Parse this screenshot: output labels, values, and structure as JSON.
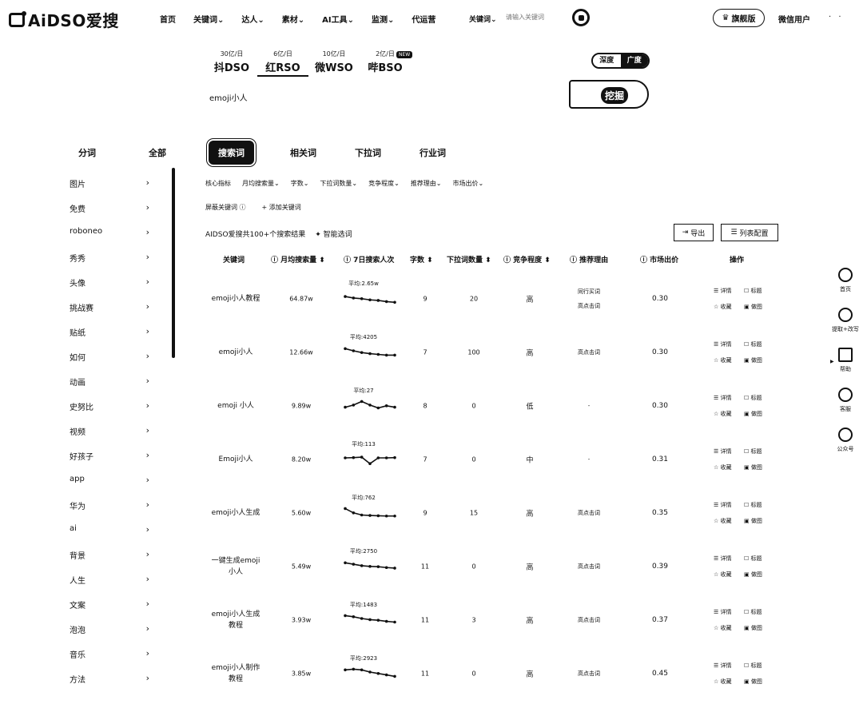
{
  "brand": {
    "name": "AiDSO爱搜"
  },
  "nav": {
    "items": [
      "首页",
      "关键词",
      "达人",
      "素材",
      "AI工具",
      "监测",
      "代运营"
    ],
    "keyword_select": "关键词",
    "search_placeholder": "请输入关键词",
    "flagship": "旗舰版",
    "user": "微信用户",
    "user_more": "· ·"
  },
  "engines": [
    {
      "volume": "30亿/日",
      "name": "抖DSO"
    },
    {
      "volume": "6亿/日",
      "name": "红RSO"
    },
    {
      "volume": "10亿/日",
      "name": "微WSO"
    },
    {
      "volume": "2亿/日",
      "name": "哔BSO"
    }
  ],
  "engine_badge": "NEW",
  "query": "emoji小人",
  "toggle": [
    "深度",
    "广度"
  ],
  "dig_button": "挖掘",
  "left_panel": {
    "tabs": [
      "分词",
      "全部"
    ],
    "categories": [
      "图片",
      "免费",
      "roboneo",
      "秀秀",
      "头像",
      "挑战赛",
      "贴纸",
      "如何",
      "动画",
      "史努比",
      "视频",
      "好孩子",
      "app",
      "华为",
      "ai",
      "背景",
      "人生",
      "文案",
      "泡泡",
      "音乐",
      "方法"
    ],
    "chevron": "›"
  },
  "main_tabs": [
    "搜索词",
    "相关词",
    "下拉词",
    "行业词"
  ],
  "filters": [
    "核心指标",
    "月均搜索量⌄",
    "字数⌄",
    "下拉词数量⌄",
    "竞争程度⌄",
    "推荐理由⌄",
    "市场出价⌄"
  ],
  "keyword_row": {
    "exclude": "屏蔽关键词 ⓘ",
    "add": "+ 添加关键词"
  },
  "result_info": {
    "summary": "AIDSO爱搜共100+个搜索结果",
    "smart": "✦ 智能选词"
  },
  "actions": {
    "export": "导出",
    "config": "列表配置"
  },
  "table": {
    "headers": [
      "关键词",
      "ⓘ 月均搜索量 ⬍",
      "ⓘ 7日搜索人次",
      "字数 ⬍",
      "下拉词数量 ⬍",
      "ⓘ 竞争程度 ⬍",
      "ⓘ 推荐理由",
      "ⓘ 市场出价",
      "操作"
    ],
    "op_labels": [
      "☰ 详情",
      "☐ 标题",
      "☆ 收藏",
      "▣ 做图"
    ],
    "rows": [
      {
        "keyword": "emoji小人教程",
        "monthly": "64.87w",
        "avg": "平均:2.65w",
        "trend": [
          0.45,
          0.55,
          0.6,
          0.68,
          0.72,
          0.8,
          0.85
        ],
        "length": "9",
        "dropdown": "20",
        "competition": "高",
        "reason": [
          "同行买词",
          "高点击词"
        ],
        "price": "0.30"
      },
      {
        "keyword": "emoji小人",
        "monthly": "12.66w",
        "avg": "平均:4205",
        "trend": [
          0.35,
          0.5,
          0.62,
          0.7,
          0.75,
          0.8,
          0.8
        ],
        "length": "7",
        "dropdown": "100",
        "competition": "高",
        "reason": [
          "高点击词"
        ],
        "price": "0.30"
      },
      {
        "keyword": "emoji 小人",
        "monthly": "9.89w",
        "avg": "平均:27",
        "trend": [
          0.7,
          0.55,
          0.3,
          0.55,
          0.75,
          0.6,
          0.7
        ],
        "length": "8",
        "dropdown": "0",
        "competition": "低",
        "reason": [
          "-"
        ],
        "price": "0.30"
      },
      {
        "keyword": "Emoji小人",
        "monthly": "8.20w",
        "avg": "平均:113",
        "trend": [
          0.5,
          0.48,
          0.45,
          0.9,
          0.5,
          0.5,
          0.48
        ],
        "length": "7",
        "dropdown": "0",
        "competition": "中",
        "reason": [
          "-"
        ],
        "price": "0.31"
      },
      {
        "keyword": "emoji小人生成",
        "monthly": "5.60w",
        "avg": "平均:762",
        "trend": [
          0.3,
          0.6,
          0.75,
          0.78,
          0.8,
          0.82,
          0.82
        ],
        "length": "9",
        "dropdown": "15",
        "competition": "高",
        "reason": [
          "高点击词"
        ],
        "price": "0.35"
      },
      {
        "keyword": "一键生成emoji小人",
        "monthly": "5.49w",
        "avg": "平均:2750",
        "trend": [
          0.35,
          0.45,
          0.55,
          0.6,
          0.62,
          0.68,
          0.72
        ],
        "length": "11",
        "dropdown": "0",
        "competition": "高",
        "reason": [
          "高点击词"
        ],
        "price": "0.39"
      },
      {
        "keyword": "emoji小人生成教程",
        "monthly": "3.93w",
        "avg": "平均:1483",
        "trend": [
          0.3,
          0.38,
          0.5,
          0.58,
          0.62,
          0.7,
          0.75
        ],
        "length": "11",
        "dropdown": "3",
        "competition": "高",
        "reason": [
          "高点击词"
        ],
        "price": "0.37"
      },
      {
        "keyword": "emoji小人制作教程",
        "monthly": "3.85w",
        "avg": "平均:2923",
        "trend": [
          0.35,
          0.3,
          0.35,
          0.5,
          0.6,
          0.7,
          0.8
        ],
        "length": "11",
        "dropdown": "0",
        "competition": "高",
        "reason": [
          "高点击词"
        ],
        "price": "0.45"
      }
    ]
  },
  "right_sidebar": [
    "首页",
    "提取+改写",
    "帮助",
    "客服",
    "公众号"
  ]
}
